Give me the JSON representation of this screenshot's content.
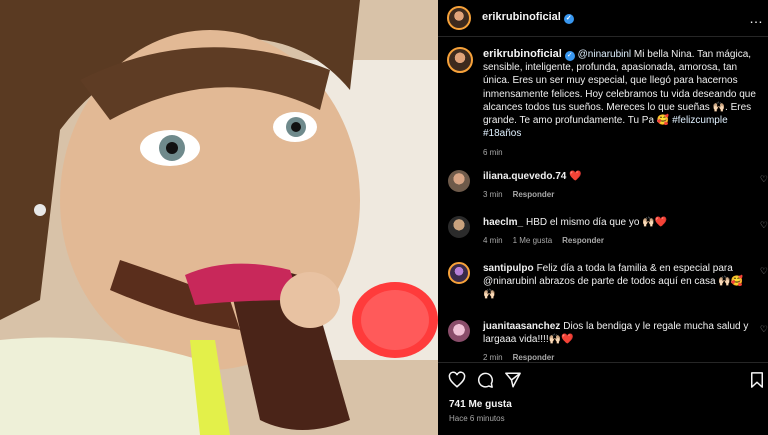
{
  "post": {
    "username": "erikrubinoficial",
    "verified_mark": "✓",
    "more_icon": "…"
  },
  "caption": {
    "username": "erikrubinoficial",
    "mention": "@ninarubinl",
    "text": " Mi bella Nina. Tan mágica, sensible, inteligente, profunda, apasionada, amorosa, tan única. Eres un ser muy especial, que llegó para hacernos inmensamente felices. Hoy celebramos tu vida deseando que alcances todos tus sueños. Mereces lo que sueñas 🙌🏻. Eres grande. Te amo profundamente. Tu Pa 🥰 ",
    "hashtag1": "#felizcumple",
    "hashtag2": "#18años",
    "time": "6 min"
  },
  "comments": [
    {
      "username": "iliana.quevedo.74",
      "text": "❤️",
      "time": "3 min",
      "likes": "",
      "reply": "Responder"
    },
    {
      "username": "haeclm_",
      "text": "HBD el mismo día que yo 🙌🏻❤️",
      "time": "4 min",
      "likes": "1 Me gusta",
      "reply": "Responder"
    },
    {
      "username": "santipulpo",
      "text": "Feliz día a toda la familia & en especial para @ninarubinl abrazos de parte de todos aquí en casa 🙌🏻🥰🙌🏻",
      "time": "",
      "likes": "",
      "reply": ""
    },
    {
      "username": "juanitaasanchez",
      "text": "Dios la bendiga y le regale mucha salud y largaaa vida!!!!🙌🏻❤️",
      "time": "2 min",
      "likes": "",
      "reply": "Responder"
    }
  ],
  "likes_label": "741 Me gusta",
  "time_ago": "Hace 6 minutos",
  "colors": {
    "background": "#000000",
    "text": "#f5f5f5",
    "muted": "#a8a8a8",
    "verified": "#3897f0",
    "divider": "#262626"
  }
}
